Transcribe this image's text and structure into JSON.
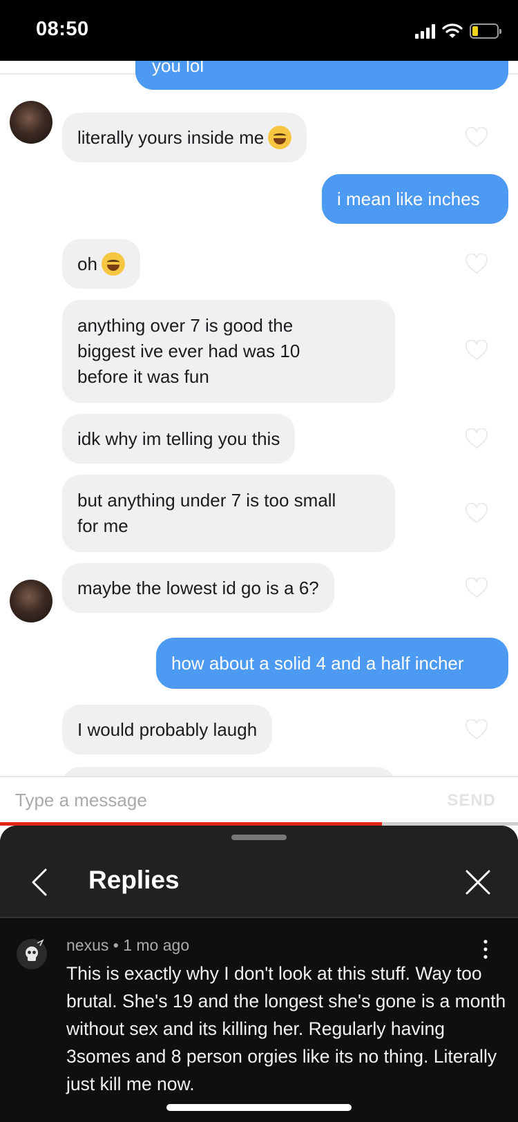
{
  "status_bar": {
    "time": "08:50",
    "icons": [
      "signal-icon",
      "wifi-icon",
      "battery-low-icon"
    ],
    "battery_color": "#f3d21a"
  },
  "chat": {
    "top_cut_text": "you lol",
    "messages": [
      {
        "side": "in",
        "text": "literally yours inside me",
        "emoji": "laughing-tears-emoji",
        "avatar": true
      },
      {
        "side": "out",
        "text": "i mean like inches"
      },
      {
        "side": "in",
        "text": "oh",
        "emoji": "sweat-smile-emoji"
      },
      {
        "side": "in",
        "text": "anything over 7 is good the\nbiggest ive ever had was 10\nbefore it was fun"
      },
      {
        "side": "in",
        "text": "idk why im telling you this"
      },
      {
        "side": "in",
        "text": "but anything under 7 is too small\nfor me"
      },
      {
        "side": "in",
        "text": "maybe the lowest id go is a 6?",
        "avatar": true
      },
      {
        "side": "out",
        "text": "how about a solid 4 and a half incher"
      },
      {
        "side": "in",
        "text": "I would probably laugh"
      }
    ],
    "colors": {
      "incoming": "#f0f0f3",
      "outgoing": "#4d9af2"
    }
  },
  "input": {
    "placeholder": "Type a message",
    "send_label": "SEND"
  },
  "video_progress": 0.737,
  "replies_sheet": {
    "title": "Replies",
    "comment": {
      "author": "nexus",
      "age": "1 mo ago",
      "meta": "nexus • 1 mo ago",
      "text": "This is exactly why I don't look at this stuff. Way too brutal. She's 19 and the longest she's gone is a month without sex and its killing her. Regularly having 3somes and 8 person orgies like its no thing. Literally just kill me now."
    }
  }
}
